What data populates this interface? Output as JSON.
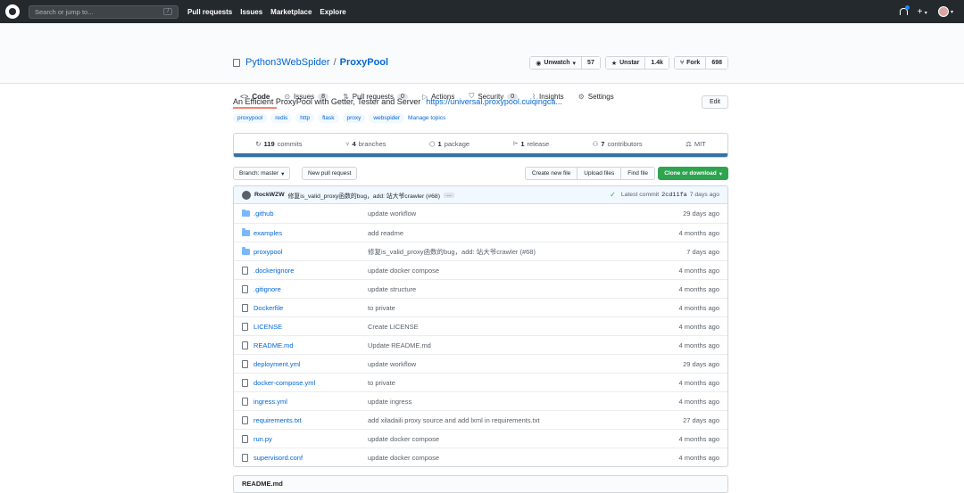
{
  "topbar": {
    "search_placeholder": "Search or jump to...",
    "search_shortcut": "/",
    "nav": [
      "Pull requests",
      "Issues",
      "Marketplace",
      "Explore"
    ]
  },
  "repo": {
    "owner": "Python3WebSpider",
    "separator": "/",
    "name": "ProxyPool",
    "watch": {
      "label": "Unwatch",
      "count": "57"
    },
    "star": {
      "label": "Unstar",
      "count": "1.4k"
    },
    "fork": {
      "label": "Fork",
      "count": "698"
    }
  },
  "tabs": [
    {
      "label": "Code",
      "icon": "<>"
    },
    {
      "label": "Issues",
      "count": "8",
      "icon": "issue-icon"
    },
    {
      "label": "Pull requests",
      "count": "0",
      "icon": "pr-icon"
    },
    {
      "label": "Actions",
      "icon": "actions-icon"
    },
    {
      "label": "Security",
      "count": "0",
      "icon": "shield-icon"
    },
    {
      "label": "Insights",
      "icon": "graph-icon"
    },
    {
      "label": "Settings",
      "icon": "gear-icon"
    }
  ],
  "about": {
    "description": "An Efficient ProxyPool with Getter, Tester and Server",
    "url": "https://universal.proxypool.cuiqingca...",
    "edit_label": "Edit",
    "topics": [
      "proxypool",
      "redis",
      "http",
      "flask",
      "proxy",
      "webspider"
    ],
    "manage_topics": "Manage topics"
  },
  "summary": {
    "commits": {
      "count": "119",
      "label": "commits"
    },
    "branches": {
      "count": "4",
      "label": "branches"
    },
    "packages": {
      "count": "1",
      "label": "package"
    },
    "releases": {
      "count": "1",
      "label": "release"
    },
    "contributors": {
      "count": "7",
      "label": "contributors"
    },
    "license": "MIT"
  },
  "filenav": {
    "branch_label": "Branch: master",
    "new_pr": "New pull request",
    "create_file": "Create new file",
    "upload_files": "Upload files",
    "find_file": "Find file",
    "clone": "Clone or download"
  },
  "commit": {
    "author": "RockWZW",
    "message": "修复is_valid_proxy函数的bug，add: 站大爷crawler (#68)",
    "ellipsis": "…",
    "latest_label": "Latest commit",
    "sha": "2cd11fa",
    "age": "7 days ago"
  },
  "files": [
    {
      "type": "dir",
      "name": ".github",
      "msg": "update workflow",
      "age": "29 days ago"
    },
    {
      "type": "dir",
      "name": "examples",
      "msg": "add readme",
      "age": "4 months ago"
    },
    {
      "type": "dir",
      "name": "proxypool",
      "msg": "修复is_valid_proxy函数的bug，add: 站大爷crawler (#68)",
      "age": "7 days ago"
    },
    {
      "type": "file",
      "name": ".dockerignore",
      "msg": "update docker compose",
      "age": "4 months ago"
    },
    {
      "type": "file",
      "name": ".gitignore",
      "msg": "update structure",
      "age": "4 months ago"
    },
    {
      "type": "file",
      "name": "Dockerfile",
      "msg": "to private",
      "age": "4 months ago"
    },
    {
      "type": "file",
      "name": "LICENSE",
      "msg": "Create LICENSE",
      "age": "4 months ago"
    },
    {
      "type": "file",
      "name": "README.md",
      "msg": "Update README.md",
      "age": "4 months ago"
    },
    {
      "type": "file",
      "name": "deployment.yml",
      "msg": "update workflow",
      "age": "29 days ago"
    },
    {
      "type": "file",
      "name": "docker-compose.yml",
      "msg": "to private",
      "age": "4 months ago"
    },
    {
      "type": "file",
      "name": "ingress.yml",
      "msg": "update ingress",
      "age": "4 months ago"
    },
    {
      "type": "file",
      "name": "requirements.txt",
      "msg": "add xiladaili proxy source and add lxml in requirements.txt",
      "age": "27 days ago"
    },
    {
      "type": "file",
      "name": "run.py",
      "msg": "update docker compose",
      "age": "4 months ago"
    },
    {
      "type": "file",
      "name": "supervisord.conf",
      "msg": "update docker compose",
      "age": "4 months ago"
    }
  ],
  "readme_label": "README.md"
}
